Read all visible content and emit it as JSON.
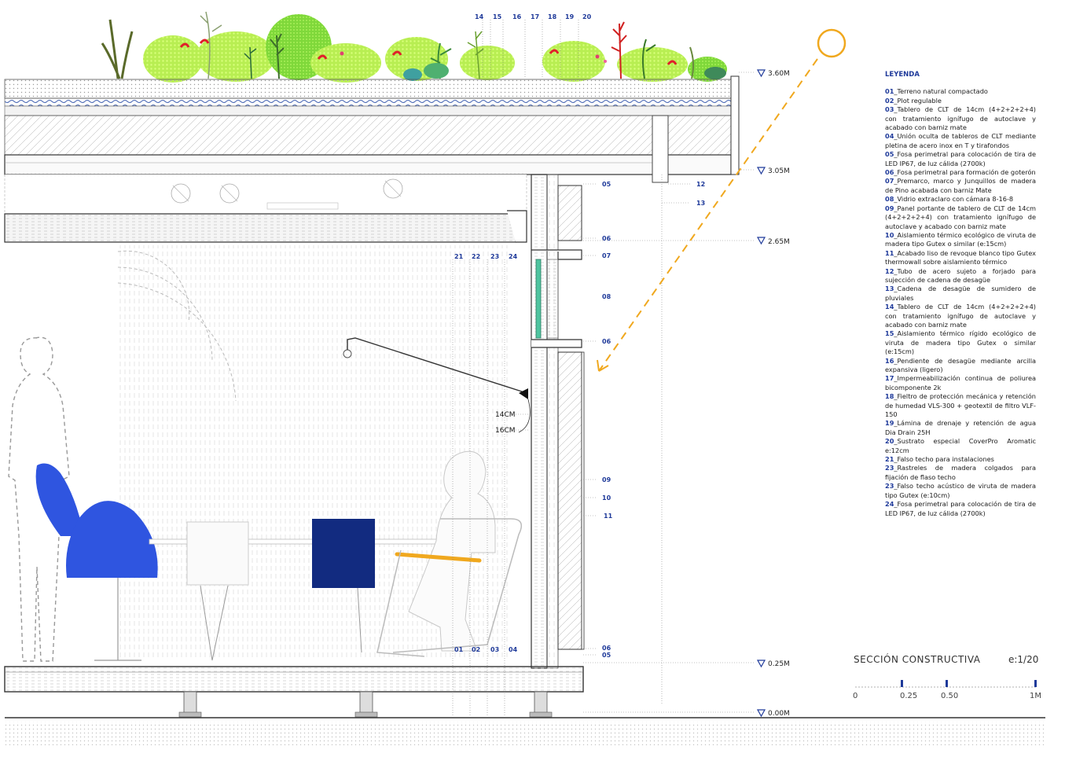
{
  "legend": {
    "title": "LEYENDA",
    "items": [
      {
        "num": "01",
        "text": "_Terreno natural compactado"
      },
      {
        "num": "02",
        "text": "_Plot regulable"
      },
      {
        "num": "03",
        "text": "_Tablero de CLT de 14cm (4+2+2+2+4) con tratamiento ignífugo de autoclave y acabado con barniz mate"
      },
      {
        "num": "04",
        "text": "_Unión oculta de tableros de CLT mediante pletina de acero inox en T y tirafondos"
      },
      {
        "num": "05",
        "text": "_Fosa perimetral para colocación de tira de LED IP67, de luz cálida (2700k)"
      },
      {
        "num": "06",
        "text": "_Fosa perimetral para formación de goterón"
      },
      {
        "num": "07",
        "text": "_Premarco, marco y Junquillos de madera de Pino acabada con barniz Mate"
      },
      {
        "num": "08",
        "text": "_Vidrio extraclaro con cámara 8-16-8"
      },
      {
        "num": "09",
        "text": "_Panel portante de tablero de CLT de 14cm (4+2+2+2+4) con tratamiento ignífugo de autoclave y acabado con barniz mate"
      },
      {
        "num": "10",
        "text": "_Aislamiento térmico ecológico de viruta de madera tipo Gutex o similar (e:15cm)"
      },
      {
        "num": "11",
        "text": "_Acabado liso de revoque blanco tipo Gutex thermowall sobre aislamiento térmico"
      },
      {
        "num": "12",
        "text": "_Tubo de acero sujeto a forjado para sujección de cadena de desagüe"
      },
      {
        "num": "13",
        "text": "_Cadena de desagüe de sumidero de pluviales"
      },
      {
        "num": "14",
        "text": "_Tablero de CLT de 14cm (4+2+2+2+4) con tratamiento ignífugo de autoclave y acabado con barniz mate"
      },
      {
        "num": "15",
        "text": "_Aislamiento térmico rígido ecológico de viruta de madera tipo Gutex o similar (e:15cm)"
      },
      {
        "num": "16",
        "text": "_Pendiente de desagüe mediante arcilla expansiva (ligero)"
      },
      {
        "num": "17",
        "text": "_Impermeabilización continua de poliurea bicomponente 2k"
      },
      {
        "num": "18",
        "text": "_Fieltro de protección mecánica y retención de humedad VLS-300 + geotextil de filtro VLF-150"
      },
      {
        "num": "19",
        "text": "_Lámina de drenaje y retención de agua Dia Drain 25H"
      },
      {
        "num": "20",
        "text": "_Sustrato especial CoverPro Aromatic e:12cm"
      },
      {
        "num": "21",
        "text": "_Falso techo para instalaciones"
      },
      {
        "num": "23",
        "text": "_Rastreles de madera colgados para fijación de flaso techo"
      },
      {
        "num": "23",
        "text": "_Falso techo acústico de viruta de madera tipo Gutex (e:10cm)"
      },
      {
        "num": "24",
        "text": "_Fosa perimetral para colocación de tira de LED IP67, de luz cálida (2700k)"
      }
    ]
  },
  "section": {
    "title": "SECCIÓN CONSTRUCTIVA",
    "scale": "e:1/20"
  },
  "scale_bar": {
    "labels": [
      "0",
      "0.25",
      "0.50",
      "1M"
    ]
  },
  "levels": {
    "l360": "3.60M",
    "l305": "3.05M",
    "l265": "2.65M",
    "l025": "0.25M",
    "l000": "0.00M"
  },
  "dimensions": {
    "d14": "14CM",
    "d16": "16CM"
  },
  "tags": {
    "t01": "01",
    "t02": "02",
    "t03": "03",
    "t04": "04",
    "t05": "05",
    "t06a": "06",
    "t07": "07",
    "t08": "08",
    "t06b": "06",
    "t09": "09",
    "t10": "10",
    "t11": "11",
    "t06c": "06",
    "t05b": "05",
    "t12": "12",
    "t13": "13",
    "t14": "14",
    "t15": "15",
    "t16": "16",
    "t17": "17",
    "t18": "18",
    "t19": "19",
    "t20": "20",
    "t21": "21",
    "t22": "22",
    "t23": "23",
    "t24": "24"
  },
  "colors": {
    "annotation_blue": "#1f3a9a",
    "chair_blue": "#2f55e0",
    "box_navy": "#122b80",
    "sun_orange": "#f0a81e",
    "green_roof": "#aee84a",
    "glass_green": "#4fc4a0"
  }
}
